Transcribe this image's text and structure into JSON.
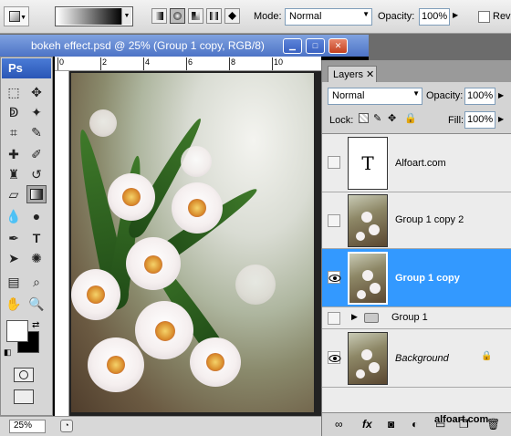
{
  "options_bar": {
    "mode_label": "Mode:",
    "mode_value": "Normal",
    "opacity_label": "Opacity:",
    "opacity_value": "100%",
    "reverse_label": "Reve"
  },
  "document": {
    "title": "bokeh effect.psd @ 25% (Group 1 copy, RGB/8)",
    "ruler_ticks": [
      "0",
      "2",
      "4",
      "6",
      "8",
      "10"
    ],
    "zoom": "25%"
  },
  "toolbox": {
    "logo": "Ps",
    "tools": [
      "marquee-icon",
      "move-icon",
      "lasso-icon",
      "magic-wand-icon",
      "crop-icon",
      "slice-icon",
      "healing-brush-icon",
      "brush-icon",
      "clone-stamp-icon",
      "history-brush-icon",
      "eraser-icon",
      "gradient-icon",
      "blur-icon",
      "dodge-icon",
      "pen-icon",
      "type-icon",
      "path-selection-icon",
      "shape-icon",
      "notes-icon",
      "eyedropper-icon",
      "hand-icon",
      "zoom-icon"
    ]
  },
  "layers_panel": {
    "tab_label": "Layers",
    "blend_mode": "Normal",
    "opacity_label": "Opacity:",
    "opacity_value": "100%",
    "lock_label": "Lock:",
    "fill_label": "Fill:",
    "fill_value": "100%",
    "layers": [
      {
        "name": "Alfoart.com",
        "visible": false,
        "kind": "text",
        "thumb_text": "T"
      },
      {
        "name": "Group 1 copy 2",
        "visible": false,
        "kind": "image"
      },
      {
        "name": "Group 1 copy",
        "visible": true,
        "kind": "image",
        "selected": true
      },
      {
        "name": "Group 1",
        "visible": false,
        "kind": "group"
      },
      {
        "name": "Background",
        "visible": true,
        "kind": "image",
        "locked": true
      }
    ]
  },
  "watermark": "alfoart.com",
  "colors": {
    "titlebar": "#4d73c6",
    "selected_layer": "#3399ff",
    "panel_bg": "#d4d4d4"
  }
}
